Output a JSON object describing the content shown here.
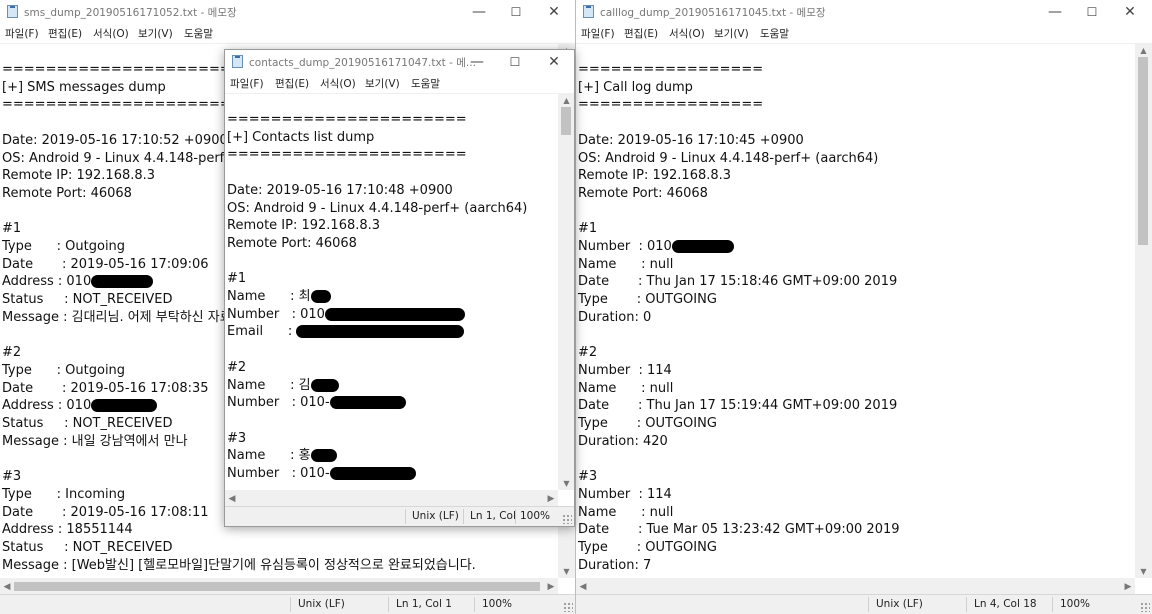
{
  "windows": {
    "sms": {
      "title": "sms_dump_20190516171052.txt - 메모장",
      "menu": [
        "파일(F)",
        "편집(E)",
        "서식(O)",
        "보기(V)",
        "도움말"
      ],
      "lines": [
        "=====================",
        "[+] SMS messages dump",
        "=====================",
        "",
        "Date: 2019-05-16 17:10:52 +0900",
        "OS: Android 9 - Linux 4.4.148-perf+ (aarch64)",
        "Remote IP: 192.168.8.3",
        "Remote Port: 46068",
        "",
        "#1",
        "Type      : Outgoing",
        "Date       : 2019-05-16 17:09:06",
        "Address : 010",
        "Status     : NOT_RECEIVED",
        "Message : 김대리님. 어제 부탁하신 자료 보내드립니다.",
        "",
        "#2",
        "Type      : Outgoing",
        "Date       : 2019-05-16 17:08:35",
        "Address : 010",
        "Status     : NOT_RECEIVED",
        "Message : 내일 강남역에서 만나",
        "",
        "#3",
        "Type      : Incoming",
        "Date       : 2019-05-16 17:08:11",
        "Address : 18551144",
        "Status     : NOT_RECEIVED",
        "Message : [Web발신] [헬로모바일]단말기에 유심등록이 정상적으로 완료되었습니다."
      ],
      "status": {
        "encoding": "Unix (LF)",
        "position": "Ln 1, Col 1",
        "zoom": "100%"
      }
    },
    "contacts": {
      "title": "contacts_dump_20190516171047.txt - 메...",
      "menu": [
        "파일(F)",
        "편집(E)",
        "서식(O)",
        "보기(V)",
        "도움말"
      ],
      "lines": [
        "======================",
        "[+] Contacts list dump",
        "======================",
        "",
        "Date: 2019-05-16 17:10:48 +0900",
        "OS: Android 9 - Linux 4.4.148-perf+ (aarch64)",
        "Remote IP: 192.168.8.3",
        "Remote Port: 46068",
        "",
        "#1",
        "Name      : 최",
        "Number   : 010",
        "Email      : ",
        "",
        "#2",
        "Name      : 김",
        "Number   : 010-",
        "",
        "#3",
        "Name      : 홍",
        "Number   : 010-"
      ],
      "status": {
        "encoding": "Unix (LF)",
        "position": "Ln 1, Col",
        "zoom": "100%"
      }
    },
    "calllog": {
      "title": "calllog_dump_20190516171045.txt - 메모장",
      "menu": [
        "파일(F)",
        "편집(E)",
        "서식(O)",
        "보기(V)",
        "도움말"
      ],
      "lines": [
        "=================",
        "[+] Call log dump",
        "=================",
        "",
        "Date: 2019-05-16 17:10:45 +0900",
        "OS: Android 9 - Linux 4.4.148-perf+ (aarch64)",
        "Remote IP: 192.168.8.3",
        "Remote Port: 46068",
        "",
        "#1",
        "Number  : 010",
        "Name      : null",
        "Date       : Thu Jan 17 15:18:46 GMT+09:00 2019",
        "Type       : OUTGOING",
        "Duration: 0",
        "",
        "#2",
        "Number  : 114",
        "Name      : null",
        "Date       : Thu Jan 17 15:19:44 GMT+09:00 2019",
        "Type       : OUTGOING",
        "Duration: 420",
        "",
        "#3",
        "Number  : 114",
        "Name      : null",
        "Date       : Tue Mar 05 13:23:42 GMT+09:00 2019",
        "Type       : OUTGOING",
        "Duration: 7"
      ],
      "status": {
        "encoding": "Unix (LF)",
        "position": "Ln 4, Col 18",
        "zoom": "100%"
      }
    }
  },
  "controls": {
    "minimize": "—",
    "maximize": "☐",
    "close": "✕"
  },
  "redactions": {
    "sms": [
      {
        "line": 12,
        "len": 62
      },
      {
        "line": 19,
        "len": 66
      }
    ],
    "contacts": [
      {
        "line": 10,
        "len": 20
      },
      {
        "line": 11,
        "len": 140
      },
      {
        "line": 12,
        "len": 168
      },
      {
        "line": 15,
        "len": 28
      },
      {
        "line": 16,
        "len": 76
      },
      {
        "line": 19,
        "len": 26
      },
      {
        "line": 20,
        "len": 86
      }
    ],
    "calllog": [
      {
        "line": 10,
        "len": 62
      }
    ]
  }
}
